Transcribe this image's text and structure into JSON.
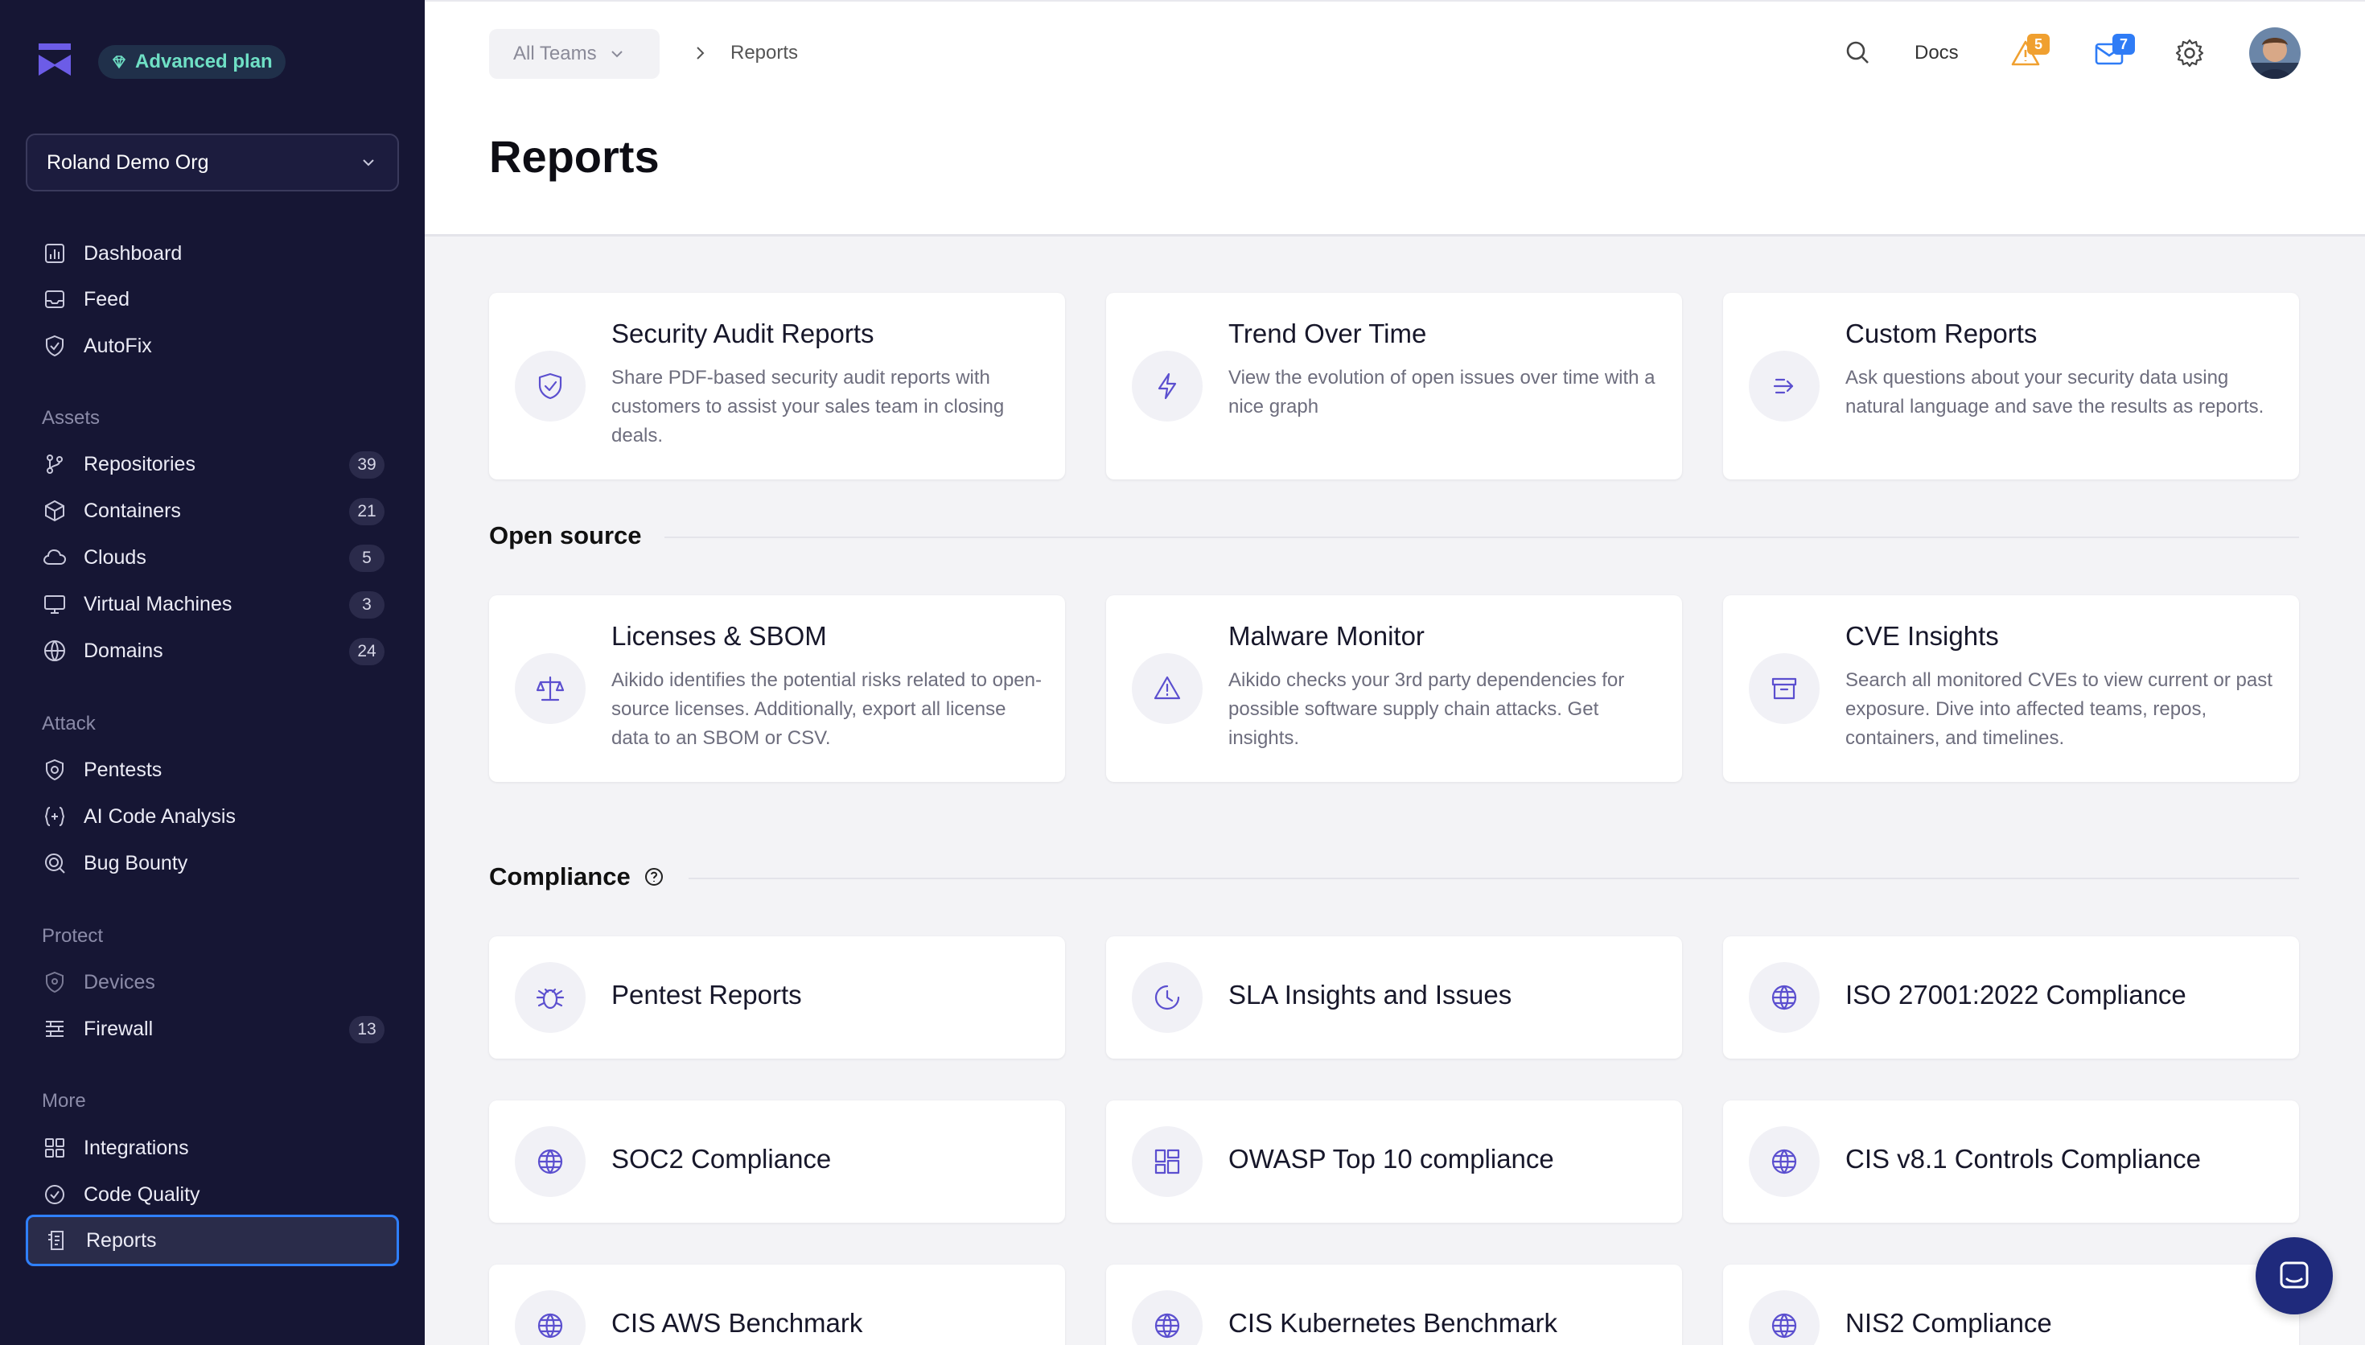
{
  "sidebar": {
    "plan_badge": "Advanced plan",
    "org_name": "Roland Demo Org",
    "top_items": [
      {
        "label": "Dashboard"
      },
      {
        "label": "Feed"
      },
      {
        "label": "AutoFix"
      }
    ],
    "sections": [
      {
        "title": "Assets",
        "items": [
          {
            "label": "Repositories",
            "count": "39"
          },
          {
            "label": "Containers",
            "count": "21"
          },
          {
            "label": "Clouds",
            "count": "5"
          },
          {
            "label": "Virtual Machines",
            "count": "3"
          },
          {
            "label": "Domains",
            "count": "24"
          }
        ]
      },
      {
        "title": "Attack",
        "items": [
          {
            "label": "Pentests"
          },
          {
            "label": "AI Code Analysis"
          },
          {
            "label": "Bug Bounty"
          }
        ]
      },
      {
        "title": "Protect",
        "items": [
          {
            "label": "Devices"
          },
          {
            "label": "Firewall",
            "count": "13"
          }
        ]
      },
      {
        "title": "More",
        "items": [
          {
            "label": "Integrations"
          },
          {
            "label": "Code Quality"
          },
          {
            "label": "Reports"
          }
        ]
      }
    ]
  },
  "header": {
    "team_select": "All Teams",
    "breadcrumb": "Reports",
    "page_title": "Reports",
    "docs_label": "Docs",
    "alerts_count": "5",
    "inbox_count": "7"
  },
  "reports": {
    "top_cards": [
      {
        "title": "Security Audit Reports",
        "description": "Share PDF-based security audit reports with customers to assist your sales team in closing deals."
      },
      {
        "title": "Trend Over Time",
        "description": "View the evolution of open issues over time with a nice graph"
      },
      {
        "title": "Custom Reports",
        "description": "Ask questions about your security data using natural language and save the results as reports."
      }
    ],
    "open_source_heading": "Open source",
    "open_source_cards": [
      {
        "title": "Licenses & SBOM",
        "description": "Aikido identifies the potential risks related to open-source licenses. Additionally, export all license data to an SBOM or CSV."
      },
      {
        "title": "Malware Monitor",
        "description": "Aikido checks your 3rd party dependencies for possible software supply chain attacks. Get insights."
      },
      {
        "title": "CVE Insights",
        "description": "Search all monitored CVEs to view current or past exposure. Dive into affected teams, repos, containers, and timelines."
      }
    ],
    "compliance_heading": "Compliance",
    "compliance_cards": [
      {
        "title": "Pentest Reports"
      },
      {
        "title": "SLA Insights and Issues"
      },
      {
        "title": "ISO 27001:2022 Compliance"
      },
      {
        "title": "SOC2 Compliance"
      },
      {
        "title": "OWASP Top 10 compliance"
      },
      {
        "title": "CIS v8.1 Controls Compliance"
      },
      {
        "title": "CIS AWS Benchmark"
      },
      {
        "title": "CIS Kubernetes Benchmark"
      },
      {
        "title": "NIS2 Compliance"
      }
    ]
  },
  "colors": {
    "sidebar_bg": "#161634",
    "accent": "#5b4fcf",
    "plan_badge_text": "#6fe0c5",
    "active_border": "#2f80ff",
    "alert_badge": "#f0a030",
    "inbox_badge": "#2f7cf6"
  }
}
